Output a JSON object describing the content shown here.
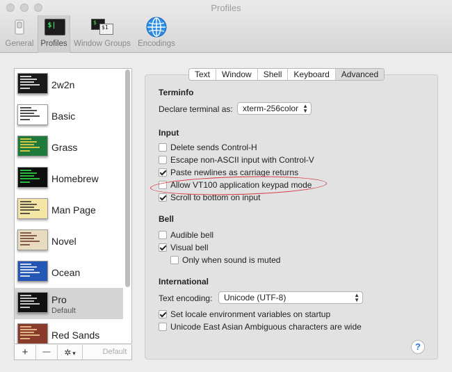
{
  "window": {
    "title": "Profiles"
  },
  "toolbar": {
    "items": [
      {
        "label": "General",
        "icon": "switch-icon"
      },
      {
        "label": "Profiles",
        "icon": "terminal-icon"
      },
      {
        "label": "Window Groups",
        "icon": "window-groups-icon"
      },
      {
        "label": "Encodings",
        "icon": "globe-icon"
      }
    ],
    "active": "Profiles",
    "prompt_glyph": "$|",
    "prompt_glyph_small": "$",
    "prompt_glyph_small2": "$1"
  },
  "profiles": [
    {
      "name": "2w2n",
      "colors": {
        "bg": "#1a1a1a",
        "fg": "#ffffff"
      }
    },
    {
      "name": "Basic",
      "colors": {
        "bg": "#ffffff",
        "fg": "#222222"
      }
    },
    {
      "name": "Grass",
      "colors": {
        "bg": "#1d7a3a",
        "fg": "#ffd84a"
      }
    },
    {
      "name": "Homebrew",
      "colors": {
        "bg": "#0d0d0d",
        "fg": "#2ee84a"
      }
    },
    {
      "name": "Man Page",
      "colors": {
        "bg": "#f4e7a6",
        "fg": "#333333"
      }
    },
    {
      "name": "Novel",
      "colors": {
        "bg": "#e8dcbf",
        "fg": "#6b3a2a"
      }
    },
    {
      "name": "Ocean",
      "colors": {
        "bg": "#2356b5",
        "fg": "#ffffff"
      }
    },
    {
      "name": "Pro",
      "subtitle": "Default",
      "selected": true,
      "colors": {
        "bg": "#111111",
        "fg": "#f2f2f2"
      }
    },
    {
      "name": "Red Sands",
      "colors": {
        "bg": "#8a3a2a",
        "fg": "#f2d39a"
      }
    }
  ],
  "list_toolbar": {
    "add": "+",
    "remove": "—",
    "gear": "✲",
    "gear_arrow": "▾",
    "default": "Default"
  },
  "tabs": [
    {
      "label": "Text"
    },
    {
      "label": "Window"
    },
    {
      "label": "Shell"
    },
    {
      "label": "Keyboard"
    },
    {
      "label": "Advanced",
      "active": true
    }
  ],
  "terminfo": {
    "heading": "Terminfo",
    "declare_label": "Declare terminal as:",
    "declare_value": "xterm-256color"
  },
  "input": {
    "heading": "Input",
    "options": [
      {
        "label": "Delete sends Control-H",
        "checked": false
      },
      {
        "label": "Escape non-ASCII input with Control-V",
        "checked": false
      },
      {
        "label": "Paste newlines as carriage returns",
        "checked": true
      },
      {
        "label": "Allow VT100 application keypad mode",
        "checked": false
      },
      {
        "label": "Scroll to bottom on input",
        "checked": true
      }
    ]
  },
  "bell": {
    "heading": "Bell",
    "options": [
      {
        "label": "Audible bell",
        "checked": false
      },
      {
        "label": "Visual bell",
        "checked": true
      },
      {
        "label": "Only when sound is muted",
        "checked": false
      }
    ]
  },
  "international": {
    "heading": "International",
    "encoding_label": "Text encoding:",
    "encoding_value": "Unicode (UTF-8)",
    "options": [
      {
        "label": "Set locale environment variables on startup",
        "checked": true
      },
      {
        "label": "Unicode East Asian Ambiguous characters are wide",
        "checked": false
      }
    ]
  },
  "help": {
    "label": "?"
  },
  "colors": {
    "accent_annotation": "#d9313a",
    "help_blue": "#2a76d6"
  }
}
